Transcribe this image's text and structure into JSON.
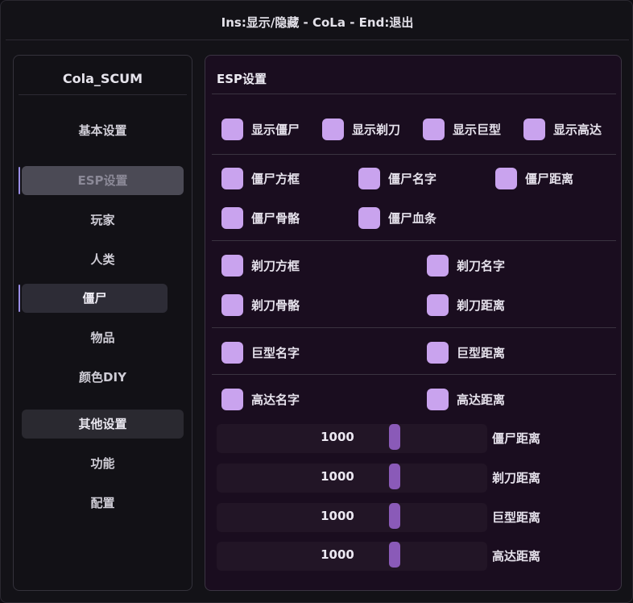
{
  "window": {
    "title": "Ins:显示/隐藏 - CoLa - End:退出"
  },
  "sidebar": {
    "brand": "Cola_SCUM",
    "items": [
      {
        "label": "基本设置"
      },
      {
        "label": "ESP设置"
      },
      {
        "label": "玩家"
      },
      {
        "label": "人类"
      },
      {
        "label": "僵尸"
      },
      {
        "label": "物品"
      },
      {
        "label": "颜色DIY"
      },
      {
        "label": "其他设置"
      },
      {
        "label": "功能"
      },
      {
        "label": "配置"
      }
    ]
  },
  "main": {
    "heading": "ESP设置",
    "checkboxes": {
      "show_zombie": "显示僵尸",
      "show_puppet": "显示剃刀",
      "show_giant": "显示巨型",
      "show_gundam": "显示高达",
      "zombie_box": "僵尸方框",
      "zombie_name": "僵尸名字",
      "zombie_distance": "僵尸距离",
      "zombie_skeleton": "僵尸骨骼",
      "zombie_health": "僵尸血条",
      "puppet_box": "剃刀方框",
      "puppet_name": "剃刀名字",
      "puppet_skeleton": "剃刀骨骼",
      "puppet_distance": "剃刀距离",
      "giant_name": "巨型名字",
      "giant_distance": "巨型距离",
      "gundam_name": "高达名字",
      "gundam_distance": "高达距离"
    },
    "checkbox_color": "#c9a3ee",
    "sliders": [
      {
        "value": "1000",
        "label": "僵尸距离"
      },
      {
        "value": "1000",
        "label": "剃刀距离"
      },
      {
        "value": "1000",
        "label": "巨型距离"
      },
      {
        "value": "1000",
        "label": "高达距离"
      }
    ]
  }
}
